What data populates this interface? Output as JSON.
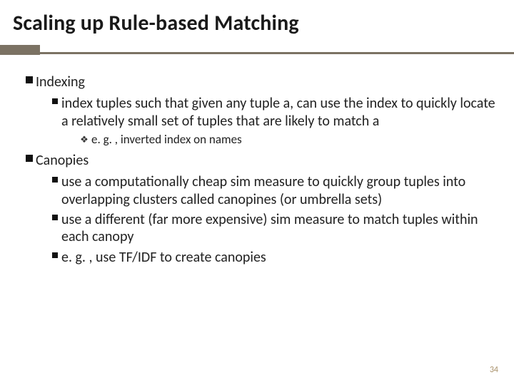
{
  "title": "Scaling up Rule-based Matching",
  "sections": {
    "indexing": {
      "heading": "Indexing",
      "sub1": "index tuples such that given any tuple a, can use the index to quickly locate a relatively small set of tuples that are likely to match a",
      "sub1_detail": "e. g. , inverted index on names"
    },
    "canopies": {
      "heading": "Canopies",
      "sub1": "use a computationally cheap sim measure to quickly group tuples into overlapping clusters called canopines (or umbrella sets)",
      "sub2": "use a different (far more expensive) sim measure to match tuples within each canopy",
      "sub3": "e. g. , use TF/IDF to create canopies"
    }
  },
  "page_number": "34"
}
